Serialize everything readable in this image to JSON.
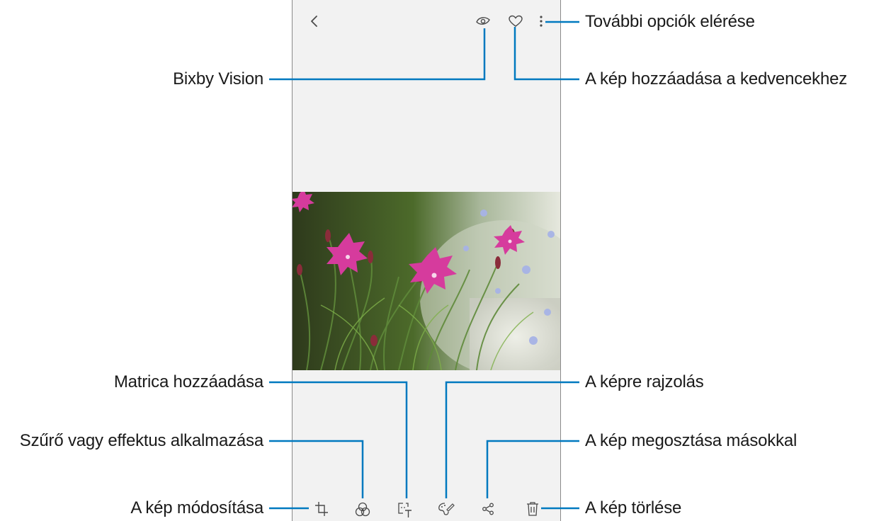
{
  "toolbar_top": {
    "back_icon": "chevron-left-icon",
    "bixby_icon": "eye-icon",
    "favorite_icon": "heart-outline-icon",
    "more_icon": "vertical-dots-icon"
  },
  "toolbar_bottom": {
    "edit_icon": "crop-icon",
    "filter_icon": "three-circles-icon",
    "sticker_icon": "sticker-text-icon",
    "draw_icon": "palette-brush-icon",
    "share_icon": "share-icon",
    "delete_icon": "trash-icon"
  },
  "callouts": {
    "more_options": "További opciók elérése",
    "favorites": "A kép hozzáadása a kedvencekhez",
    "bixby": "Bixby Vision",
    "sticker": "Matrica hozzáadása",
    "draw": "A képre rajzolás",
    "filter": "Szűrő vagy effektus alkalmazása",
    "share": "A kép megosztása másokkal",
    "edit": "A kép módosítása",
    "delete": "A kép törlése"
  },
  "colors": {
    "callout_line": "#0079bf",
    "icon": "#4a4a4a",
    "screen_bg": "#f2f2f2",
    "flower": "#d63b9d"
  }
}
